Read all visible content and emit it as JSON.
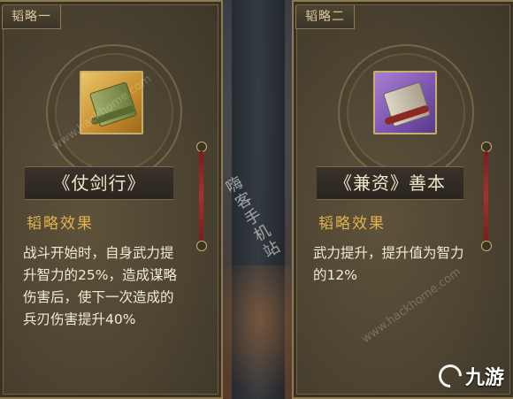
{
  "panels": [
    {
      "tab": "韬略一",
      "item_name": "《仗剑行》",
      "effect_title": "韬略效果",
      "effect_text": "战斗开始时，自身武力提升智力的25%，造成谋略伤害后，使下一次造成的兵刃伤害提升40%",
      "icon": "green-scroll-icon"
    },
    {
      "tab": "韬略二",
      "item_name": "《兼资》善本",
      "effect_title": "韬略效果",
      "effect_text": "武力提升，提升值为智力的12%",
      "icon": "purple-scroll-icon"
    }
  ],
  "watermark": {
    "vertical": "嗨客手机站",
    "url": "www.hackhome.com"
  },
  "logo": {
    "text": "九游"
  },
  "colors": {
    "effect_title": "#e1b44f",
    "panel_border": "#8c7a52",
    "green_icon_bg": "#c78c2c",
    "purple_icon_bg": "#7a52b0"
  }
}
